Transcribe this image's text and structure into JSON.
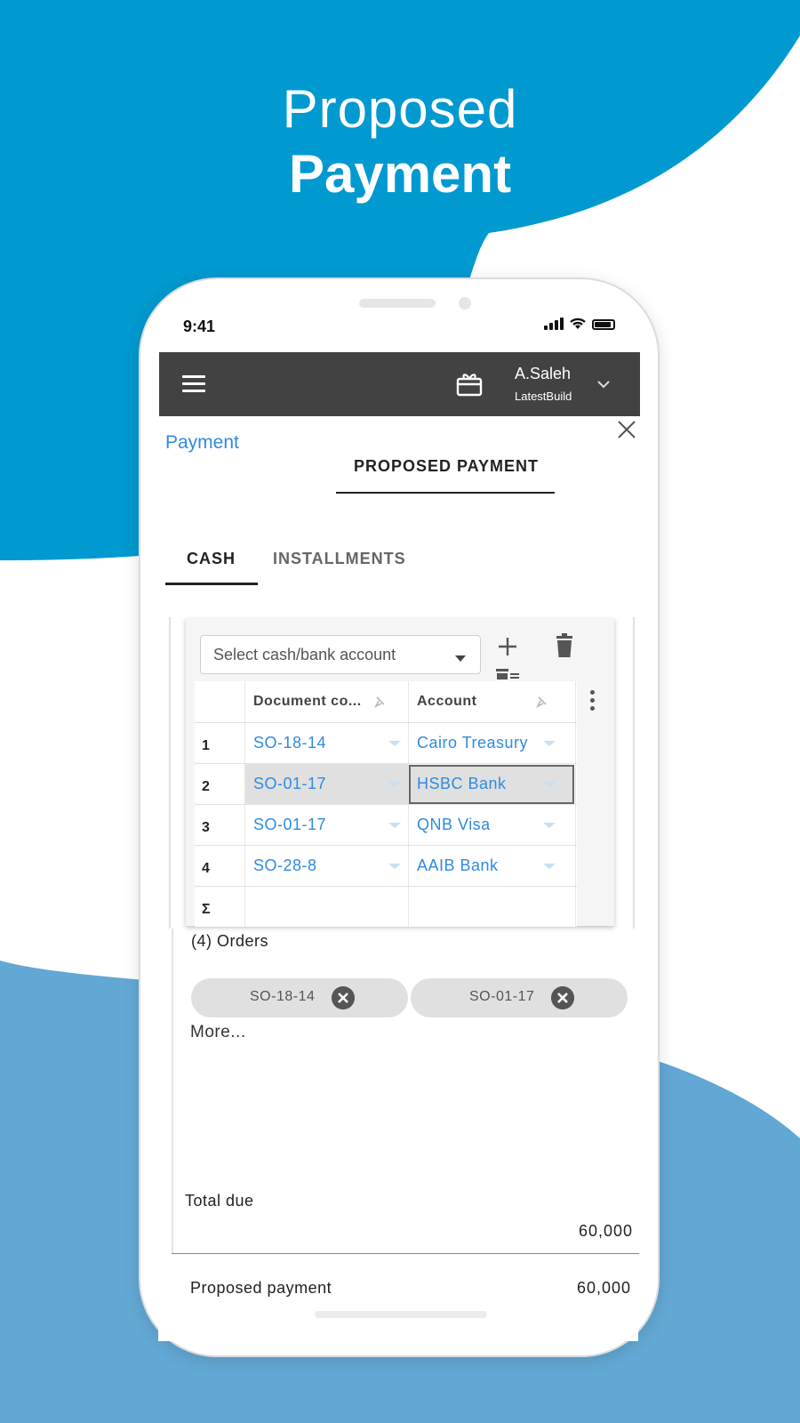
{
  "hero": {
    "line1": "Proposed",
    "line2": "Payment"
  },
  "colors": {
    "brand_blue_top": "#0099d0",
    "brand_blue_bottom": "#62a8d4",
    "appbar": "#424242",
    "link": "#2f8be0"
  },
  "status": {
    "time": "9:41"
  },
  "appbar": {
    "user_name": "A.Saleh",
    "user_sub": "LatestBuild",
    "menu_icon": "hamburger-icon",
    "gift_icon": "gift-icon",
    "chevron_icon": "chevron-down-icon"
  },
  "page": {
    "breadcrumb": "Payment",
    "active_tab": "PROPOSED PAYMENT"
  },
  "subtabs": {
    "cash": "CASH",
    "installments": "INSTALLMENTS"
  },
  "account_select": {
    "placeholder": "Select cash/bank account"
  },
  "table": {
    "headers": [
      "Document co...",
      "Account"
    ],
    "rows": [
      {
        "num": "1",
        "doc": "SO-18-14",
        "account": "Cairo Treasury"
      },
      {
        "num": "2",
        "doc": "SO-01-17",
        "account": "HSBC Bank"
      },
      {
        "num": "3",
        "doc": "SO-01-17",
        "account": "QNB Visa"
      },
      {
        "num": "4",
        "doc": "SO-28-8",
        "account": "AAIB Bank"
      }
    ],
    "sum_symbol": "Σ"
  },
  "orders": {
    "title": "(4) Orders",
    "chips": [
      "SO-18-14",
      "SO-01-17"
    ],
    "more": "More..."
  },
  "totals": {
    "total_due_label": "Total due",
    "total_due_value": "60,000",
    "proposed_label": "Proposed payment",
    "proposed_value": "60,000"
  }
}
